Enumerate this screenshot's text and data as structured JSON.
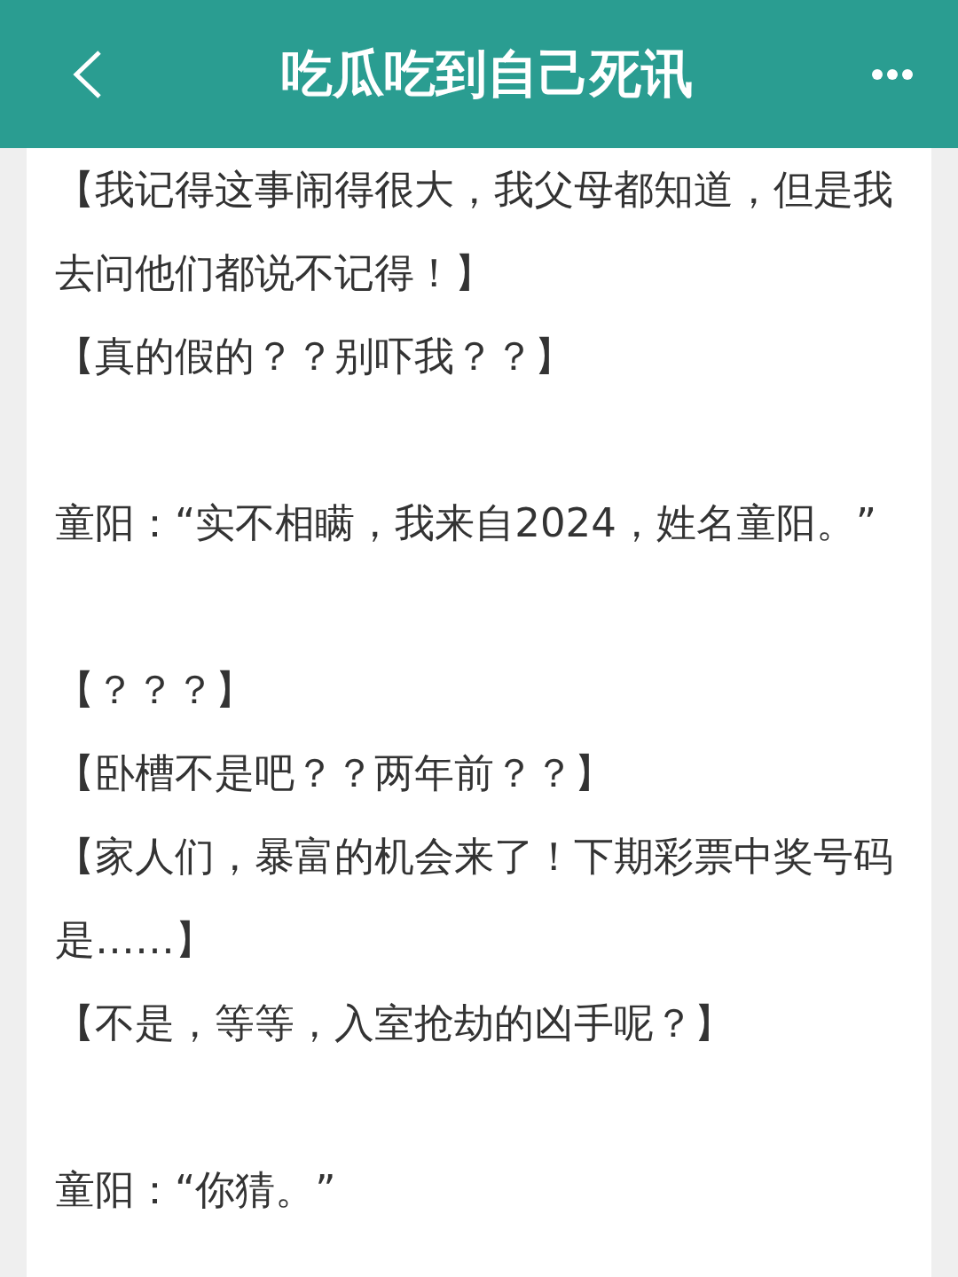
{
  "header": {
    "title": "吃瓜吃到自己死讯"
  },
  "paragraphs": [
    {
      "kind": "comment",
      "text": "【我记得这事闹得很大，我父母都知道，但是我去问他们都说不记得！】"
    },
    {
      "kind": "comment",
      "text": "【真的假的？？别吓我？？】"
    },
    {
      "kind": "speech",
      "text": "童阳：“实不相瞒，我来自2024，姓名童阳。”"
    },
    {
      "kind": "comment",
      "text": "【？？？】"
    },
    {
      "kind": "comment",
      "text": "【卧槽不是吧？？两年前？？】"
    },
    {
      "kind": "comment",
      "text": "【家人们，暴富的机会来了！下期彩票中奖号码是……】"
    },
    {
      "kind": "comment",
      "text": "【不是，等等，入室抢劫的凶手呢？】"
    },
    {
      "kind": "speech",
      "text": "童阳：“你猜。”"
    }
  ]
}
